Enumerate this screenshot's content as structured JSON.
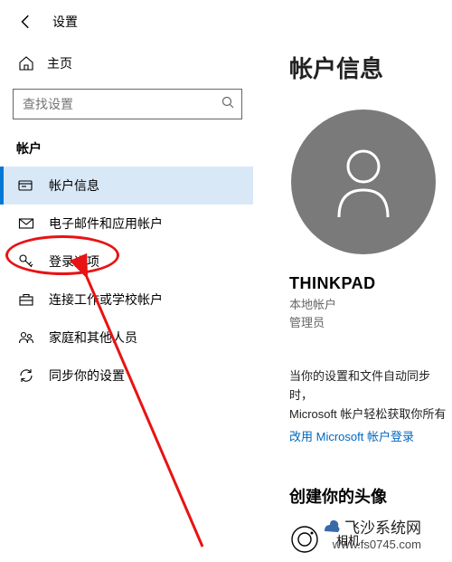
{
  "header": {
    "title": "设置"
  },
  "sidebar": {
    "home_label": "主页",
    "search_placeholder": "查找设置",
    "category_label": "帐户",
    "items": [
      {
        "label": "帐户信息"
      },
      {
        "label": "电子邮件和应用帐户"
      },
      {
        "label": "登录选项"
      },
      {
        "label": "连接工作或学校帐户"
      },
      {
        "label": "家庭和其他人员"
      },
      {
        "label": "同步你的设置"
      }
    ]
  },
  "content": {
    "title": "帐户信息",
    "username": "THINKPAD",
    "account_type": "本地帐户",
    "account_role": "管理员",
    "sync_text1": "当你的设置和文件自动同步时，",
    "sync_text2": "Microsoft 帐户轻松获取你所有",
    "link_text": "改用 Microsoft 帐户登录",
    "create_avatar_heading": "创建你的头像",
    "camera_label": "相机"
  },
  "watermark": {
    "title": "飞沙系统网",
    "url": "www.fs0745.com"
  }
}
